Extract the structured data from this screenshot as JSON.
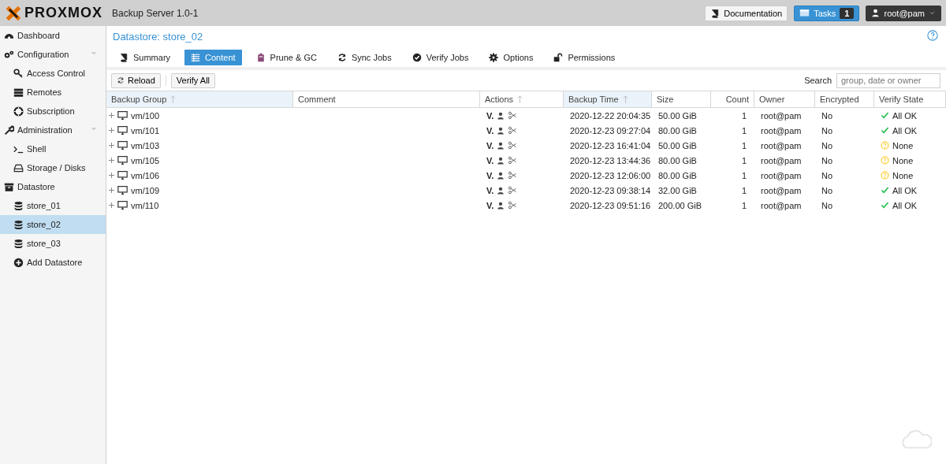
{
  "header": {
    "brand": "PROXMOX",
    "product": "Backup Server 1.0-1",
    "documentation": "Documentation",
    "tasks": "Tasks",
    "task_count": "1",
    "user": "root@pam"
  },
  "sidebar": {
    "items": [
      {
        "label": "Dashboard",
        "kind": "section",
        "selected": false
      },
      {
        "label": "Configuration",
        "kind": "section",
        "expanded": true,
        "selected": false
      },
      {
        "label": "Access Control",
        "kind": "child",
        "selected": false
      },
      {
        "label": "Remotes",
        "kind": "child",
        "selected": false
      },
      {
        "label": "Subscription",
        "kind": "child",
        "selected": false
      },
      {
        "label": "Administration",
        "kind": "section",
        "expanded": true,
        "selected": false
      },
      {
        "label": "Shell",
        "kind": "child",
        "selected": false
      },
      {
        "label": "Storage / Disks",
        "kind": "child",
        "selected": false
      },
      {
        "label": "Datastore",
        "kind": "section",
        "selected": false
      },
      {
        "label": "store_01",
        "kind": "child",
        "selected": false
      },
      {
        "label": "store_02",
        "kind": "child",
        "selected": true
      },
      {
        "label": "store_03",
        "kind": "child",
        "selected": false
      },
      {
        "label": "Add Datastore",
        "kind": "child",
        "selected": false
      }
    ]
  },
  "panel": {
    "title": "Datastore: store_02"
  },
  "tabs": [
    {
      "label": "Summary",
      "selected": false
    },
    {
      "label": "Content",
      "selected": true
    },
    {
      "label": "Prune & GC",
      "selected": false
    },
    {
      "label": "Sync Jobs",
      "selected": false
    },
    {
      "label": "Verify Jobs",
      "selected": false
    },
    {
      "label": "Options",
      "selected": false
    },
    {
      "label": "Permissions",
      "selected": false
    }
  ],
  "toolbar": {
    "reload": "Reload",
    "verify_all": "Verify All",
    "search_label": "Search",
    "search_placeholder": "group, date or owner"
  },
  "table": {
    "columns": [
      {
        "label": "Backup Group",
        "sorted": true,
        "active": true
      },
      {
        "label": "Comment",
        "sorted": false,
        "active": false
      },
      {
        "label": "Actions",
        "sorted": true,
        "active": false
      },
      {
        "label": "Backup Time",
        "sorted": true,
        "active": true
      },
      {
        "label": "Size",
        "sorted": false,
        "active": false
      },
      {
        "label": "Count",
        "sorted": false,
        "active": false
      },
      {
        "label": "Owner",
        "sorted": false,
        "active": false
      },
      {
        "label": "Encrypted",
        "sorted": false,
        "active": false
      },
      {
        "label": "Verify State",
        "sorted": false,
        "active": false
      }
    ],
    "rows": [
      {
        "group": "vm/100",
        "verify_action": "V.",
        "time": "2020-12-22 20:04:35",
        "size": "50.00 GiB",
        "count": "1",
        "owner": "root@pam",
        "encrypted": "No",
        "verify": "All OK",
        "verified": true
      },
      {
        "group": "vm/101",
        "verify_action": "V.",
        "time": "2020-12-23 09:27:04",
        "size": "80.00 GiB",
        "count": "1",
        "owner": "root@pam",
        "encrypted": "No",
        "verify": "All OK",
        "verified": true
      },
      {
        "group": "vm/103",
        "verify_action": "V.",
        "time": "2020-12-23 16:41:04",
        "size": "50.00 GiB",
        "count": "1",
        "owner": "root@pam",
        "encrypted": "No",
        "verify": "None",
        "verified": false
      },
      {
        "group": "vm/105",
        "verify_action": "V.",
        "time": "2020-12-23 13:44:36",
        "size": "80.00 GiB",
        "count": "1",
        "owner": "root@pam",
        "encrypted": "No",
        "verify": "None",
        "verified": false
      },
      {
        "group": "vm/106",
        "verify_action": "V.",
        "time": "2020-12-23 12:06:00",
        "size": "80.00 GiB",
        "count": "1",
        "owner": "root@pam",
        "encrypted": "No",
        "verify": "None",
        "verified": false
      },
      {
        "group": "vm/109",
        "verify_action": "V.",
        "time": "2020-12-23 09:38:14",
        "size": "32.00 GiB",
        "count": "1",
        "owner": "root@pam",
        "encrypted": "No",
        "verify": "All OK",
        "verified": true
      },
      {
        "group": "vm/110",
        "verify_action": "V.",
        "time": "2020-12-23 09:51:16",
        "size": "200.00 GiB",
        "count": "1",
        "owner": "root@pam",
        "encrypted": "No",
        "verify": "All OK",
        "verified": true
      }
    ]
  }
}
